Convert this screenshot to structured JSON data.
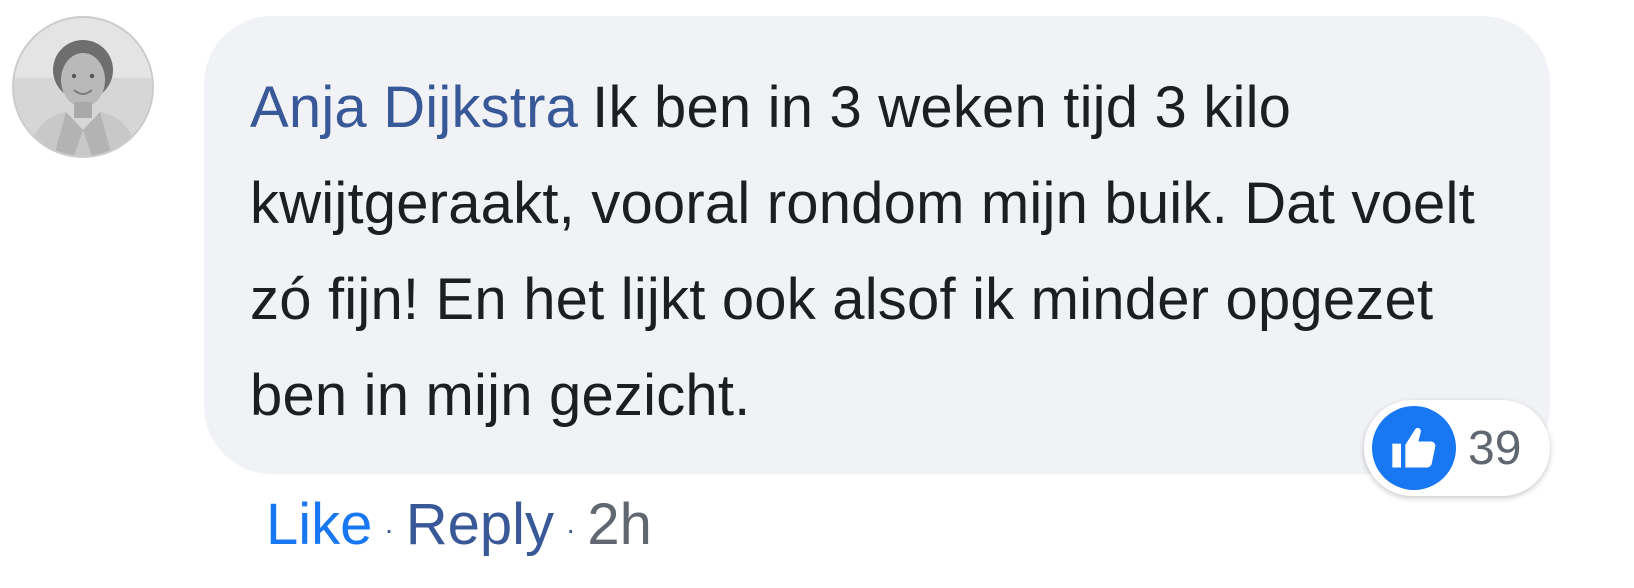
{
  "comment": {
    "author": "Anja Dijkstra",
    "text": "Ik ben in 3 weken tijd 3 kilo kwijtgeraakt, vooral rondom mijn buik. Dat voelt zó fijn! En het lijkt ook alsof ik minder opgezet ben in mijn gezicht.",
    "avatar_icon": "profile-photo-icon"
  },
  "reaction": {
    "icon": "thumbs-up-icon",
    "count": "39",
    "color": "#1877f2"
  },
  "actions": {
    "like_label": "Like",
    "separator": "·",
    "reply_label": "Reply",
    "timestamp": "2h"
  },
  "colors": {
    "author": "#385898",
    "bubble": "#f0f2f5",
    "text": "#1c1e21",
    "muted": "#606770",
    "like": "#1877f2"
  }
}
